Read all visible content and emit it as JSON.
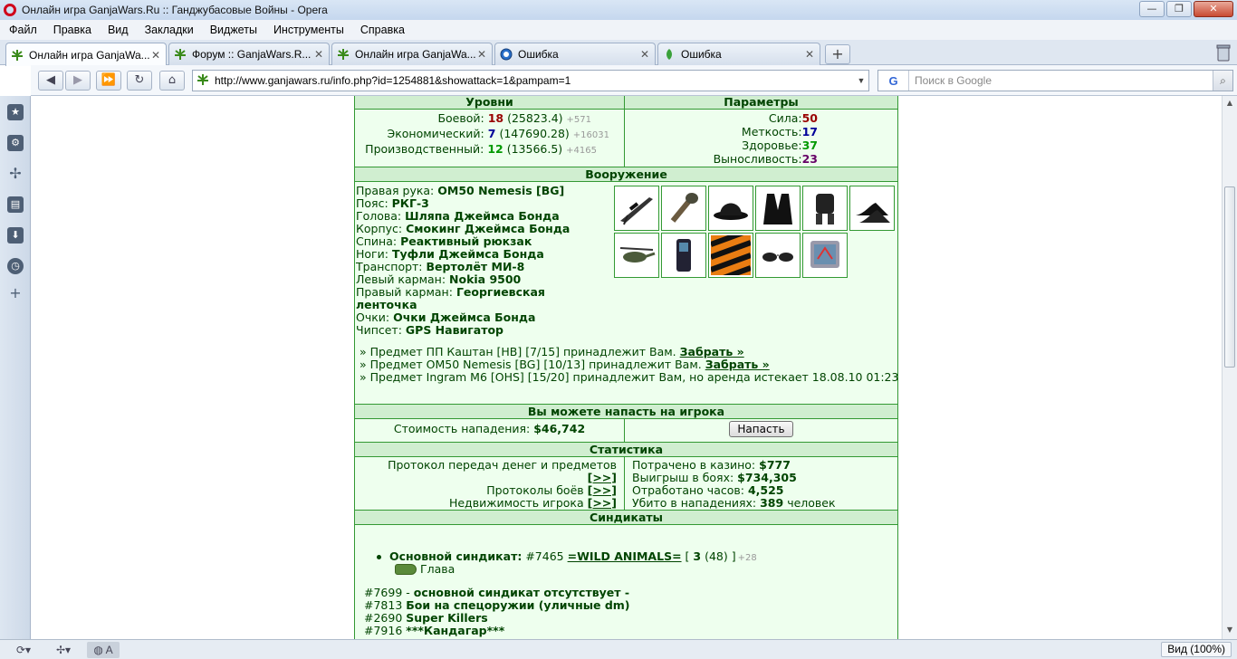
{
  "window": {
    "title": "Онлайн игра GanjaWars.Ru :: Ганджубасовые Войны - Opera",
    "buttons": [
      "—",
      "❐",
      "✕"
    ]
  },
  "menu": [
    "Файл",
    "Правка",
    "Вид",
    "Закладки",
    "Виджеты",
    "Инструменты",
    "Справка"
  ],
  "tabs": [
    {
      "label": "Онлайн игра GanjaWa...",
      "active": true
    },
    {
      "label": "Форум :: GanjaWars.R...",
      "active": false
    },
    {
      "label": "Онлайн игра GanjaWa...",
      "active": false
    },
    {
      "label": "Ошибка",
      "active": false
    },
    {
      "label": "Ошибка",
      "active": false
    }
  ],
  "newtab_label": "+",
  "address": {
    "url": "http://www.ganjawars.ru/info.php?id=1254881&showattack=1&pampam=1"
  },
  "search": {
    "placeholder": "Поиск в Google",
    "engine": "G"
  },
  "status": {
    "zoom": "Вид (100%)"
  },
  "levels": {
    "header": "Уровни",
    "combat": {
      "label": "Боевой:",
      "level": "18",
      "exp": "(25823.4)",
      "gain": "+571"
    },
    "economic": {
      "label": "Экономический:",
      "level": "7",
      "exp": "(147690.28)",
      "gain": "+16031"
    },
    "production": {
      "label": "Производственный:",
      "level": "12",
      "exp": "(13566.5)",
      "gain": "+4165"
    }
  },
  "params": {
    "header": "Параметры",
    "strength": {
      "label": "Сила:",
      "value": "50"
    },
    "accuracy": {
      "label": "Меткость:",
      "value": "17"
    },
    "health": {
      "label": "Здоровье:",
      "value": "37"
    },
    "endurance": {
      "label": "Выносливость:",
      "value": "23"
    }
  },
  "armament": {
    "header": "Вооружение",
    "slots": [
      {
        "label": "Правая рука:",
        "value": "OM50 Nemesis [BG]"
      },
      {
        "label": "Пояс:",
        "value": "РКГ-3"
      },
      {
        "label": "Голова:",
        "value": "Шляпа Джеймса Бонда"
      },
      {
        "label": "Корпус:",
        "value": "Смокинг Джеймса Бонда"
      },
      {
        "label": "Спина:",
        "value": "Реактивный рюкзак"
      },
      {
        "label": "Ноги:",
        "value": "Туфли Джеймса Бонда"
      },
      {
        "label": "Транспорт:",
        "value": "Вертолёт МИ-8"
      },
      {
        "label": "Левый карман:",
        "value": "Nokia 9500"
      },
      {
        "label": "Правый карман:",
        "value": "Георгиевская"
      },
      {
        "label": "",
        "value": "ленточка"
      },
      {
        "label": "Очки:",
        "value": "Очки Джеймса Бонда"
      },
      {
        "label": "Чипсет:",
        "value": "GPS Навигатор"
      }
    ],
    "item_icons": [
      "rifle-icon",
      "grenade-icon",
      "bowler-hat-icon",
      "tuxedo-icon",
      "jetpack-icon",
      "shoes-icon",
      "helicopter-icon",
      "phone-icon",
      "ribbon-icon",
      "sunglasses-icon",
      "gps-icon"
    ],
    "owned": [
      {
        "text": "» Предмет ПП Каштан [HB] [7/15] принадлежит Вам.",
        "link": "Забрать »"
      },
      {
        "text": "» Предмет OM50 Nemesis [BG] [10/13] принадлежит Вам.",
        "link": "Забрать »"
      },
      {
        "text": "» Предмет Ingram M6 [OHS] [15/20] принадлежит Вам, но аренда истекает 18.08.10 01:23",
        "link": ""
      }
    ]
  },
  "attack": {
    "header": "Вы можете напасть на игрока",
    "cost_label": "Стоимость нападения:",
    "cost_value": "$46,742",
    "button": "Напасть"
  },
  "stats": {
    "header": "Статистика",
    "left": [
      {
        "label": "Протокол передач денег и предметов",
        "link": "[>>]"
      },
      {
        "label": "Протоколы боёв",
        "link": "[>>]"
      },
      {
        "label": "Недвижимость игрока",
        "link": "[>>]"
      }
    ],
    "right": [
      {
        "label": "Потрачено в казино:",
        "value": "$777",
        "suffix": ""
      },
      {
        "label": "Выигрыш в боях:",
        "value": "$734,305",
        "suffix": ""
      },
      {
        "label": "Отработано часов:",
        "value": "4,525",
        "suffix": ""
      },
      {
        "label": "Убито в нападениях:",
        "value": "389",
        "suffix": "человек"
      }
    ]
  },
  "syndicates": {
    "header": "Синдикаты",
    "primary_label": "Основной синдикат:",
    "primary_id": "#7465",
    "primary_name": "=WILD ANIMALS=",
    "primary_level_open": "[",
    "primary_level": "3",
    "primary_level_rest": "(48) ]",
    "primary_gain": "+28",
    "rank": "Глава",
    "list": [
      {
        "id": "#7699",
        "sep": " - ",
        "name": "основной синдикат отсутствует -"
      },
      {
        "id": "#7813",
        "sep": " ",
        "name": "Бои на спецоружии (уличные dm)"
      },
      {
        "id": "#2690",
        "sep": " ",
        "name": "Super Killers"
      },
      {
        "id": "#7916",
        "sep": " ",
        "name": "***Кандагар***"
      }
    ]
  }
}
